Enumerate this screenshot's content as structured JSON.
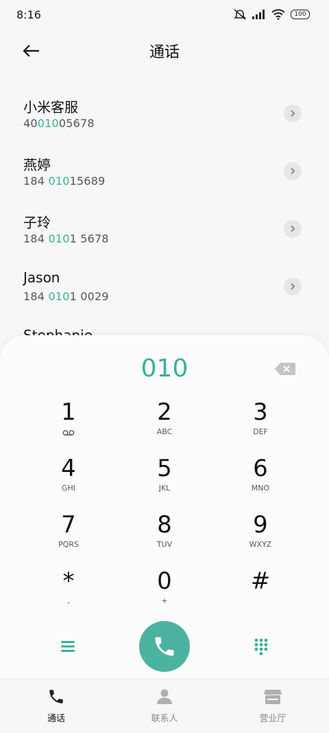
{
  "status_bar": {
    "time": "8:16",
    "battery": "100"
  },
  "header": {
    "title": "通话"
  },
  "contacts": [
    {
      "name": "小米客服",
      "number_parts": [
        "40",
        "010",
        "05678"
      ]
    },
    {
      "name": "燕婷",
      "number_parts": [
        "184 ",
        "010",
        "15689"
      ]
    },
    {
      "name": "子玲",
      "number_parts": [
        "184 ",
        "010",
        "1 5678"
      ]
    },
    {
      "name": "Jason",
      "number_parts": [
        "184 ",
        "010",
        "1 0029"
      ]
    },
    {
      "name": "Stephanie",
      "number_parts": [
        "",
        "",
        ""
      ]
    }
  ],
  "dialer": {
    "entry": "010",
    "keys": [
      {
        "digit": "1",
        "letters": ""
      },
      {
        "digit": "2",
        "letters": "ABC"
      },
      {
        "digit": "3",
        "letters": "DEF"
      },
      {
        "digit": "4",
        "letters": "GHI"
      },
      {
        "digit": "5",
        "letters": "JKL"
      },
      {
        "digit": "6",
        "letters": "MNO"
      },
      {
        "digit": "7",
        "letters": "PQRS"
      },
      {
        "digit": "8",
        "letters": "TUV"
      },
      {
        "digit": "9",
        "letters": "WXYZ"
      },
      {
        "digit": "*",
        "letters": ","
      },
      {
        "digit": "0",
        "letters": "+"
      },
      {
        "digit": "#",
        "letters": ""
      }
    ]
  },
  "tabs": [
    {
      "label": "通话",
      "icon": "phone-icon",
      "active": true
    },
    {
      "label": "联系人",
      "icon": "person-icon",
      "active": false
    },
    {
      "label": "营业厅",
      "icon": "store-icon",
      "active": false
    }
  ],
  "colors": {
    "accent": "#3aaf9a",
    "call_button": "#4bb3a0"
  }
}
